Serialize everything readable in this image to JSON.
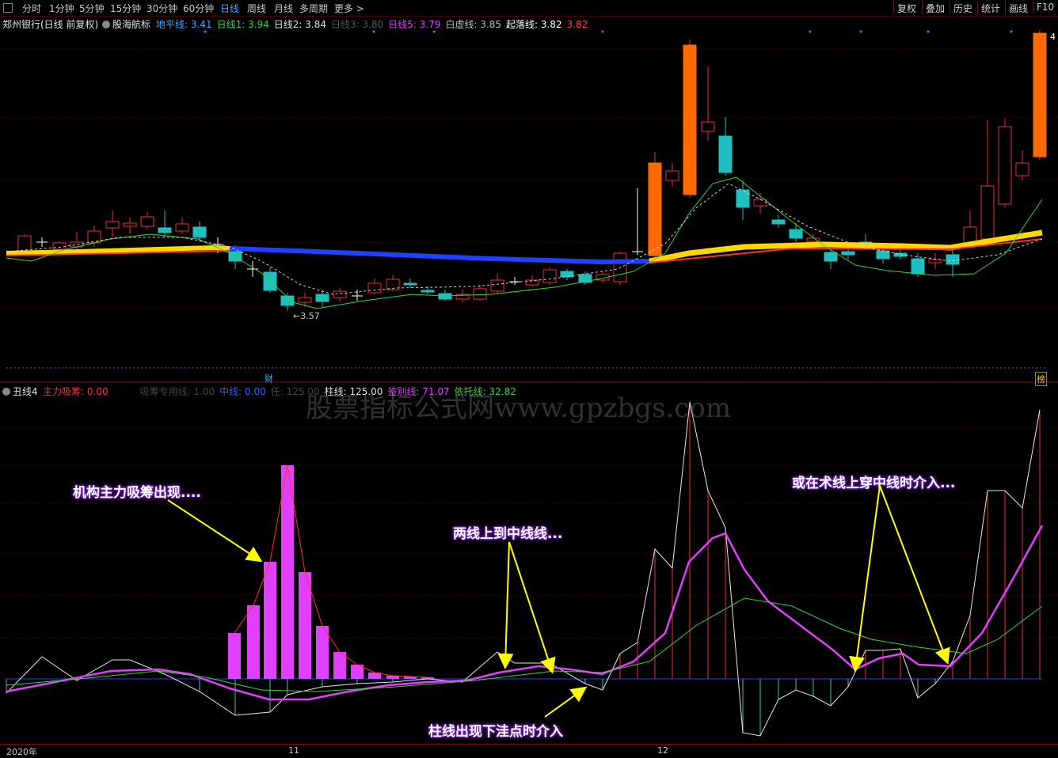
{
  "toolbar": {
    "timeframes": [
      "分时",
      "1分钟",
      "5分钟",
      "15分钟",
      "30分钟",
      "60分钟",
      "日线",
      "周线",
      "月线",
      "多周期",
      "更多 >"
    ],
    "active": "日线",
    "right_buttons": [
      "复权",
      "叠加",
      "历史",
      "统计",
      "画线",
      "F10"
    ]
  },
  "main_legend": {
    "stock": "郑州银行(日线 前复权)",
    "indicator": "股海航标",
    "items": [
      {
        "label": "地平线: 3.41",
        "color": "#3aa8ff"
      },
      {
        "label": "日线1: 3.94",
        "color": "#37d337"
      },
      {
        "label": "日线2: 3.84",
        "color": "#e0e0e0"
      },
      {
        "label": "日线3: 3.80",
        "color": "#555555"
      },
      {
        "label": "日线5: 3.79",
        "color": "#e040fb"
      },
      {
        "label": "白虚线: 3.85",
        "color": "#bbbbbb"
      },
      {
        "label": "起落线: 3.82",
        "color": "#ffffff"
      },
      {
        "label": "3.82",
        "color": "#ff4040"
      }
    ]
  },
  "main_chart": {
    "low_marker": "←3.57",
    "right_marker": "4",
    "finance_tag": "财",
    "corner_tag": "榜"
  },
  "sub_legend": {
    "name": "丑线4",
    "items": [
      {
        "label": "主力吸筹: 0.00",
        "color": "#ff3030"
      },
      {
        "label": "吸筹专用线: 1.00",
        "color": "#444444"
      },
      {
        "label": "中线: 0.00",
        "color": "#3060ff"
      },
      {
        "label": "任: 125.00",
        "color": "#444444"
      },
      {
        "label": "柱线: 125.00",
        "color": "#e0e0e0"
      },
      {
        "label": "鉴别线: 71.07",
        "color": "#e040fb"
      },
      {
        "label": "依托线: 32.82",
        "color": "#37d337"
      }
    ]
  },
  "watermark": "股票指标公式网www.gpzbgs.com",
  "callouts": {
    "c1": "机构主力吸筹出现....",
    "c2": "两线上到中线线...",
    "c3": "或在术线上穿中线时介入...",
    "c4": "柱线出现下洼点时介入"
  },
  "x_axis": {
    "l1": "2020年",
    "l2": "11",
    "l3": "12"
  }
}
